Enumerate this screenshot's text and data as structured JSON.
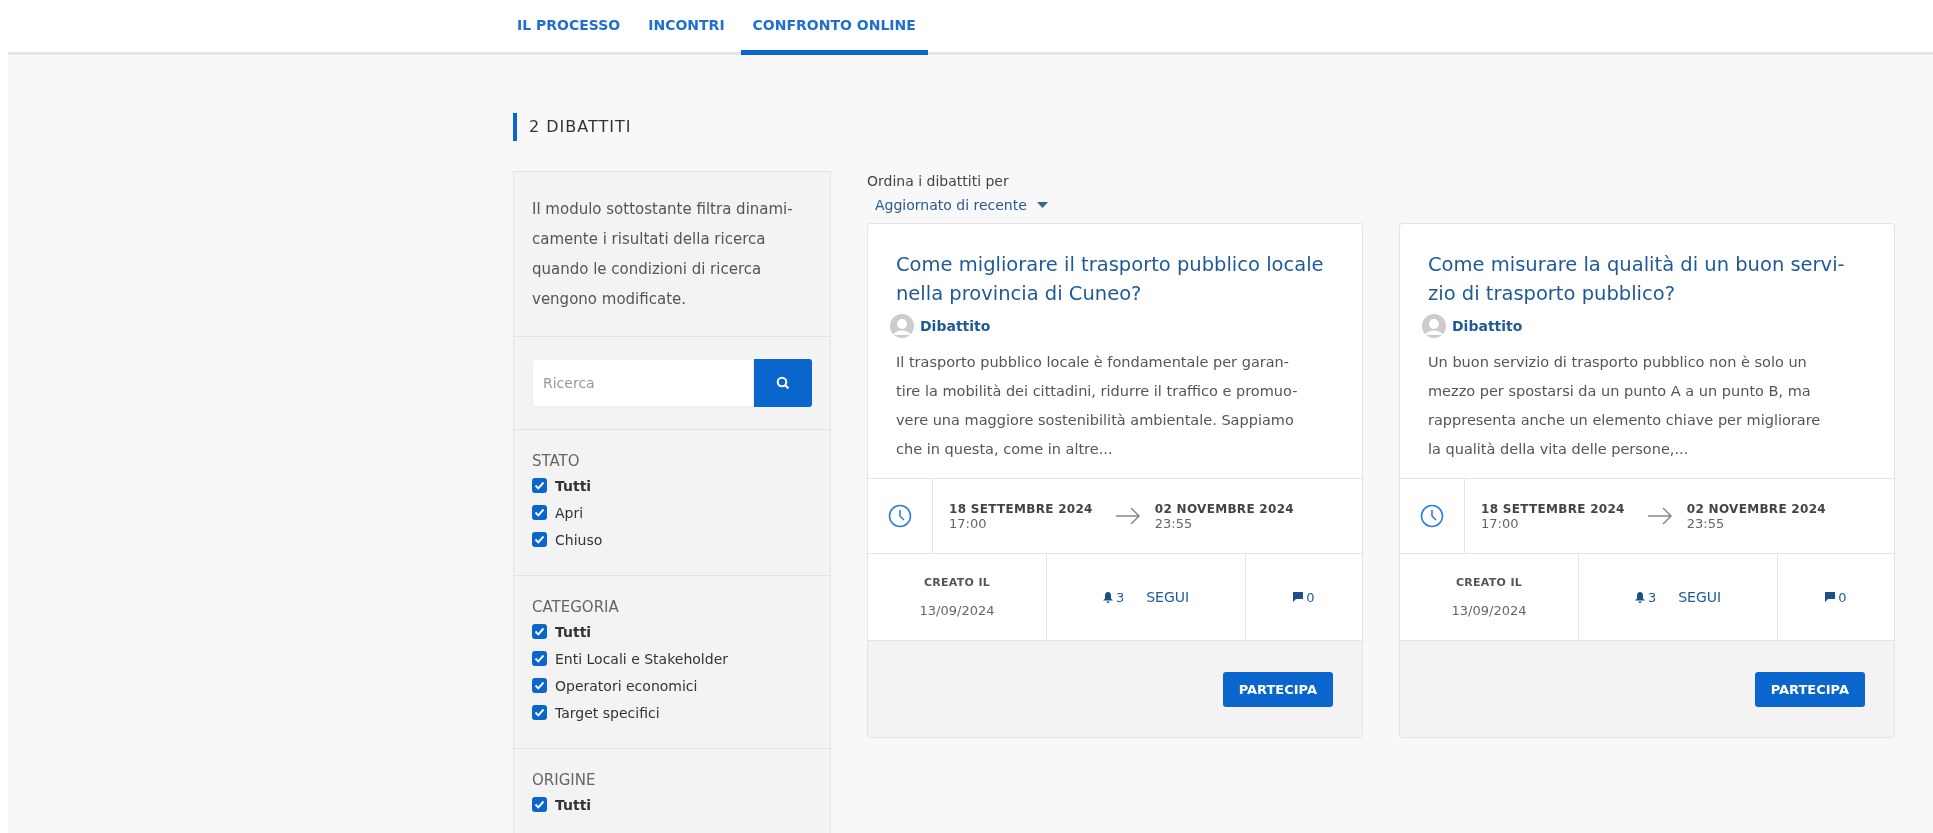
{
  "nav": {
    "tabs": [
      {
        "label": "IL PROCESSO",
        "selected": false
      },
      {
        "label": "INCONTRI",
        "selected": false
      },
      {
        "label": "CONFRONTO ONLINE",
        "selected": true
      }
    ]
  },
  "heading": "2 DIBATTITI",
  "sidebar": {
    "intro_lines": [
      "Il modulo sottostante filtra dinami-",
      "camente i risultati della ricerca",
      "quando le condizioni di ricerca",
      "vengono modificate."
    ],
    "search": {
      "placeholder": "Ricerca"
    },
    "filters": [
      {
        "title": "STATO",
        "options": [
          {
            "label": "Tutti",
            "checked": true,
            "all": true
          },
          {
            "label": "Apri",
            "checked": true,
            "all": false
          },
          {
            "label": "Chiuso",
            "checked": true,
            "all": false
          }
        ]
      },
      {
        "title": "CATEGORIA",
        "options": [
          {
            "label": "Tutti",
            "checked": true,
            "all": true
          },
          {
            "label": "Enti Locali e Stakeholder",
            "checked": true,
            "all": false
          },
          {
            "label": "Operatori economici",
            "checked": true,
            "all": false
          },
          {
            "label": "Target specifici",
            "checked": true,
            "all": false
          }
        ]
      },
      {
        "title": "ORIGINE",
        "options": [
          {
            "label": "Tutti",
            "checked": true,
            "all": true
          }
        ]
      }
    ]
  },
  "sort": {
    "label": "Ordina i dibattiti per",
    "value": "Aggiornato di recente"
  },
  "cards": [
    {
      "title_lines": [
        "Come migliorare il trasporto pubblico locale",
        "nella provincia di Cuneo?"
      ],
      "type": "Dibattito",
      "excerpt_lines": [
        "Il trasporto pubblico locale è fondamentale per garan-",
        "tire la mobilità dei cittadini, ridurre il traffico e promuo-",
        "vere una maggiore sostenibilità ambientale. Sappiamo",
        "che in questa, come in altre..."
      ],
      "start_date": "18 SETTEMBRE 2024",
      "start_time": "17:00",
      "end_date": "02 NOVEMBRE 2024",
      "end_time": "23:55",
      "created_label": "CREATO IL",
      "created_date": "13/09/2024",
      "followers": "3",
      "follow": "SEGUI",
      "comments": "0",
      "action": "PARTECIPA"
    },
    {
      "title_lines": [
        "Come misurare la qualità di un buon servi-",
        "zio di trasporto pubblico?"
      ],
      "type": "Dibattito",
      "excerpt_lines": [
        "Un buon servizio di trasporto pubblico non è solo un",
        "mezzo per spostarsi da un punto A a un punto B, ma",
        "rappresenta anche un elemento chiave per migliorare",
        "la qualità della vita delle persone,..."
      ],
      "start_date": "18 SETTEMBRE 2024",
      "start_time": "17:00",
      "end_date": "02 NOVEMBRE 2024",
      "end_time": "23:55",
      "created_label": "CREATO IL",
      "created_date": "13/09/2024",
      "followers": "3",
      "follow": "SEGUI",
      "comments": "0",
      "action": "PARTECIPA"
    }
  ]
}
